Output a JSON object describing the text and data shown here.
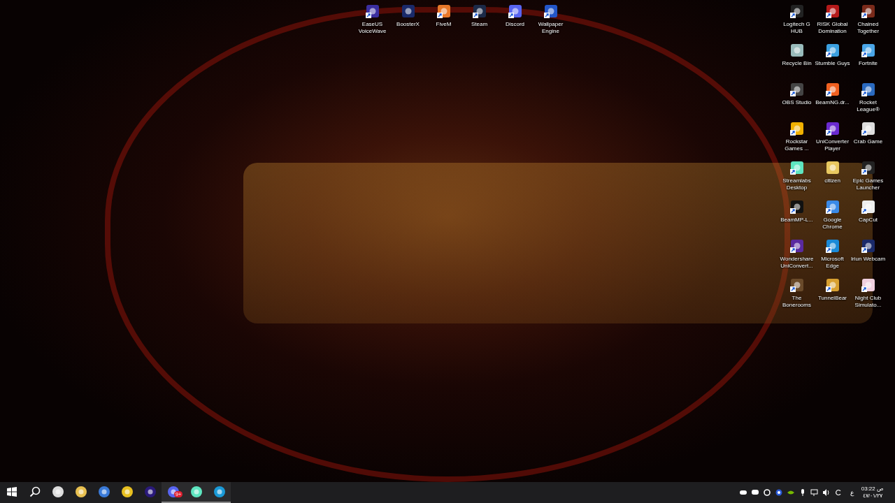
{
  "desktop": {
    "top_icons": [
      {
        "label": "EaseUS VoiceWave",
        "shortcut": true
      },
      {
        "label": "BoosterX",
        "shortcut": false
      },
      {
        "label": "FiveM",
        "shortcut": true
      },
      {
        "label": "Steam",
        "shortcut": true
      },
      {
        "label": "Discord",
        "shortcut": true
      },
      {
        "label": "Wallpaper Engine",
        "shortcut": true
      }
    ],
    "right_icons": [
      {
        "label": "Logitech G HUB",
        "shortcut": true
      },
      {
        "label": "RISK Global Domination",
        "shortcut": true
      },
      {
        "label": "Chained Together",
        "shortcut": true
      },
      {
        "label": "Recycle Bin",
        "shortcut": false
      },
      {
        "label": "Stumble Guys",
        "shortcut": true
      },
      {
        "label": "Fortnite",
        "shortcut": true
      },
      {
        "label": "OBS Studio",
        "shortcut": true
      },
      {
        "label": "BeamNG.dr...",
        "shortcut": true
      },
      {
        "label": "Rocket League®",
        "shortcut": true
      },
      {
        "label": "Rockstar Games ...",
        "shortcut": true
      },
      {
        "label": "UniConverter Player",
        "shortcut": true
      },
      {
        "label": "Crab Game",
        "shortcut": true
      },
      {
        "label": "Streamlabs Desktop",
        "shortcut": true
      },
      {
        "label": "citizen",
        "shortcut": false
      },
      {
        "label": "Epic Games Launcher",
        "shortcut": true
      },
      {
        "label": "BeamMP-L...",
        "shortcut": true
      },
      {
        "label": "Google Chrome",
        "shortcut": true
      },
      {
        "label": "CapCut",
        "shortcut": true
      },
      {
        "label": "Wondershare UniConvert...",
        "shortcut": true
      },
      {
        "label": "Microsoft Edge",
        "shortcut": true
      },
      {
        "label": "Iriun Webcam",
        "shortcut": true
      },
      {
        "label": "The Bonerooms",
        "shortcut": true
      },
      {
        "label": "TunnelBear",
        "shortcut": true
      },
      {
        "label": "Night Club Simulato...",
        "shortcut": true
      }
    ]
  },
  "taskbar": {
    "apps": [
      {
        "kind": "start",
        "running": false
      },
      {
        "kind": "search",
        "running": false
      },
      {
        "kind": "app",
        "running": false
      },
      {
        "kind": "app",
        "running": false
      },
      {
        "kind": "app",
        "running": false
      },
      {
        "kind": "app",
        "running": false
      },
      {
        "kind": "app",
        "running": false
      },
      {
        "kind": "app",
        "running": true,
        "badge": "9+"
      },
      {
        "kind": "app",
        "running": true
      },
      {
        "kind": "app",
        "running": true
      }
    ],
    "language": "ع",
    "clock": {
      "time": "03:22 ص",
      "date": "٤٧/٠١/٢٧"
    }
  }
}
